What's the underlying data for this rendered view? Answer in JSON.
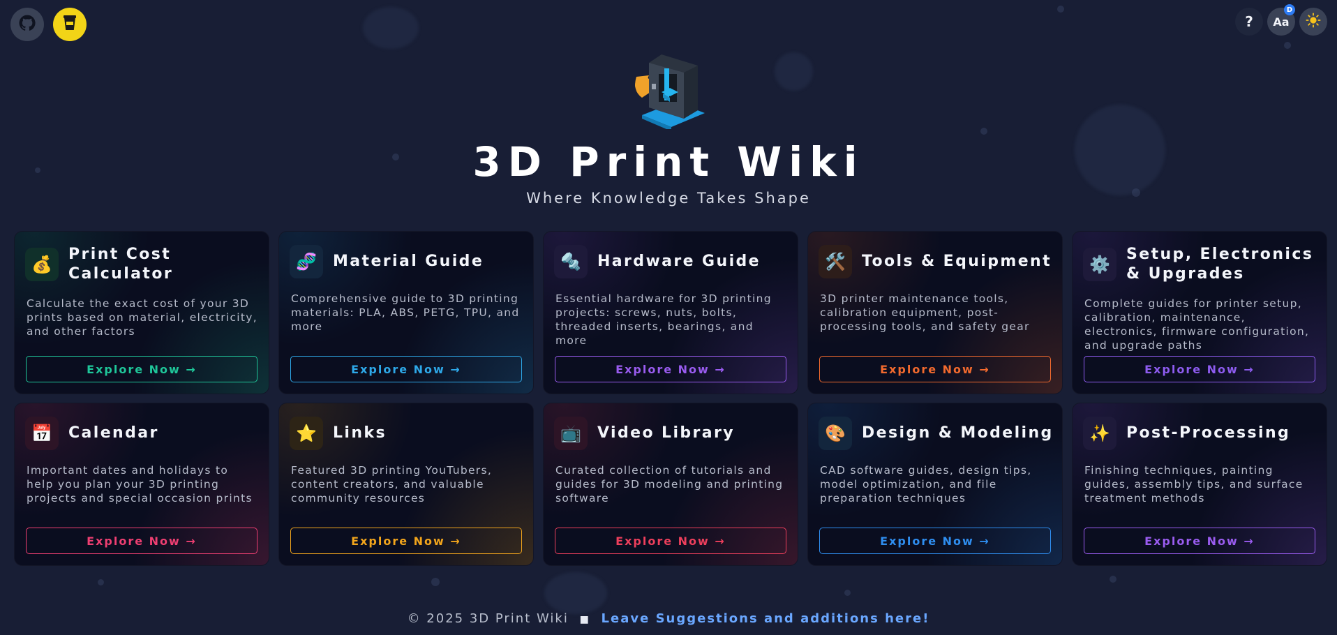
{
  "header": {
    "github_icon": "github-icon",
    "coffee_icon": "coffee-cup-icon",
    "help_label": "?",
    "font_label": "Aa",
    "font_badge": "D",
    "theme_icon": "sun-icon"
  },
  "hero": {
    "logo_icon": "3d-printer-logo",
    "title": "3D Print Wiki",
    "subtitle": "Where Knowledge Takes Shape"
  },
  "cards": [
    {
      "title": "Print Cost Calculator",
      "icon": "money-bag-icon",
      "glyph": "💰",
      "desc": "Calculate the exact cost of your 3D prints based on material, electricity, and other factors",
      "button": "Explore Now →",
      "accent": "#1fc79a",
      "icon_bg": "#10302a"
    },
    {
      "title": "Material Guide",
      "icon": "dna-icon",
      "glyph": "🧬",
      "desc": "Comprehensive guide to 3D printing materials: PLA, ABS, PETG, TPU, and more",
      "button": "Explore Now →",
      "accent": "#2ea8e8",
      "icon_bg": "#13263d"
    },
    {
      "title": "Hardware Guide",
      "icon": "screw-icon",
      "glyph": "🔩",
      "desc": "Essential hardware for 3D printing projects: screws, nuts, bolts, threaded inserts, bearings, and more",
      "button": "Explore Now →",
      "accent": "#9a5cf0",
      "icon_bg": "#1e1a3a"
    },
    {
      "title": "Tools & Equipment",
      "icon": "hammer-wrench-icon",
      "glyph": "🛠️",
      "desc": "3D printer maintenance tools, calibration equipment, post-processing tools, and safety gear",
      "button": "Explore Now →",
      "accent": "#f26a2e",
      "icon_bg": "#2d1d1a"
    },
    {
      "title": "Setup, Electronics & Upgrades",
      "icon": "gear-icon",
      "glyph": "⚙️",
      "desc": "Complete guides for printer setup, calibration, maintenance, electronics, firmware configuration, and upgrade paths",
      "button": "Explore Now →",
      "accent": "#8e5cf0",
      "icon_bg": "#1e1a3a"
    },
    {
      "title": "Calendar",
      "icon": "calendar-icon",
      "glyph": "📅",
      "desc": "Important dates and holidays to help you plan your 3D printing projects and special occasion prints",
      "button": "Explore Now →",
      "accent": "#ef3f72",
      "icon_bg": "#2d1426"
    },
    {
      "title": "Links",
      "icon": "star-icon",
      "glyph": "⭐",
      "desc": "Featured 3D printing YouTubers, content creators, and valuable community resources",
      "button": "Explore Now →",
      "accent": "#f2a51c",
      "icon_bg": "#2d2416"
    },
    {
      "title": "Video Library",
      "icon": "tv-icon",
      "glyph": "📺",
      "desc": "Curated collection of tutorials and guides for 3D modeling and printing software",
      "button": "Explore Now →",
      "accent": "#ee3f5c",
      "icon_bg": "#2d1426"
    },
    {
      "title": "Design & Modeling",
      "icon": "palette-icon",
      "glyph": "🎨",
      "desc": "CAD software guides, design tips, model optimization, and file preparation techniques",
      "button": "Explore Now →",
      "accent": "#2f8ef0",
      "icon_bg": "#13263d"
    },
    {
      "title": "Post-Processing",
      "icon": "sparkles-icon",
      "glyph": "✨",
      "desc": "Finishing techniques, painting guides, assembly tips, and surface treatment methods",
      "button": "Explore Now →",
      "accent": "#9a5cf0",
      "icon_bg": "#1e1a3a"
    }
  ],
  "footer": {
    "copyright": "© 2025 3D Print Wiki",
    "separator": "■",
    "link": "Leave Suggestions and additions here!"
  }
}
